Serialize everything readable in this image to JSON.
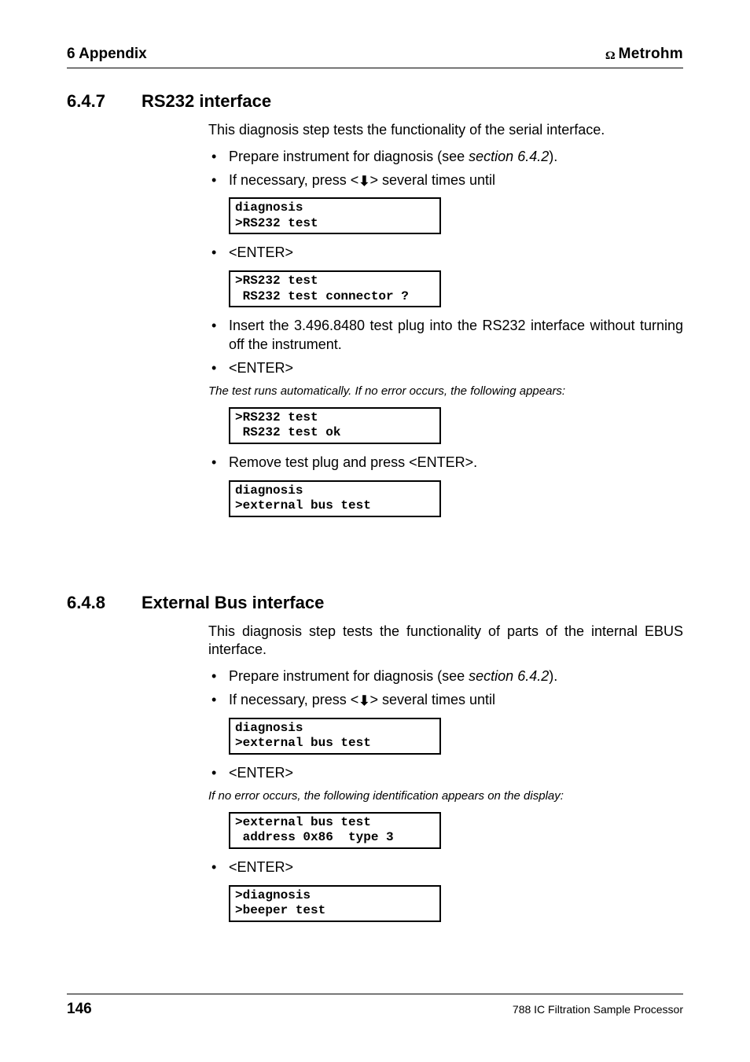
{
  "header": {
    "chapter": "6  Appendix",
    "brand_symbol": "Ω",
    "brand_name": "Metrohm"
  },
  "section647": {
    "num": "6.4.7",
    "title": "RS232 interface",
    "intro": "This diagnosis step tests the functionality of the serial interface.",
    "b1_a": "Prepare instrument for diagnosis (see ",
    "b1_i": "section 6.4.2",
    "b1_c": ").",
    "b2_a": "If necessary, press <",
    "b2_arrow": "⬇",
    "b2_c": "> several times until",
    "lcd1": "diagnosis\n>RS232 test",
    "b3": "<ENTER>",
    "lcd2": ">RS232 test\n RS232 test connector ?",
    "b4": "Insert the 3.496.8480 test plug into the RS232 interface without turning off the instrument.",
    "b5": "<ENTER>",
    "note1": "The test runs automatically. If no error occurs, the following appears:",
    "lcd3": ">RS232 test\n RS232 test ok",
    "b6": "Remove test plug and press <ENTER>.",
    "lcd4": "diagnosis\n>external bus test"
  },
  "section648": {
    "num": "6.4.8",
    "title": "External Bus interface",
    "intro": "This diagnosis step tests the functionality of parts of the internal EBUS interface.",
    "b1_a": "Prepare instrument for diagnosis (see ",
    "b1_i": "section 6.4.2",
    "b1_c": ").",
    "b2_a": "If necessary, press <",
    "b2_arrow": "⬇",
    "b2_c": "> several times until",
    "lcd1": "diagnosis\n>external bus test",
    "b3": "<ENTER>",
    "note1": "If no error occurs, the following identification appears on the display:",
    "lcd2": ">external bus test\n address 0x86  type 3",
    "b4": "<ENTER>",
    "lcd3": ">diagnosis\n>beeper test"
  },
  "footer": {
    "page": "146",
    "doc": "788 IC Filtration Sample Processor"
  }
}
